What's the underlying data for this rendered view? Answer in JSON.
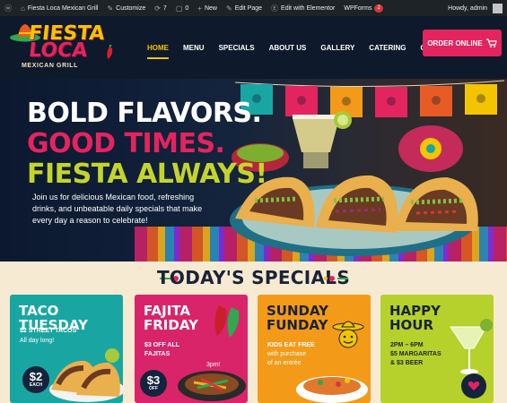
{
  "admin_bar": {
    "site_name": "Fiesta Loca Mexican Grill",
    "customize": "Customize",
    "updates": "7",
    "comments": "0",
    "new": "New",
    "edit_page": "Edit Page",
    "elementor": "Edit with Elementor",
    "wpforms": "WPForms",
    "wpforms_count": "2",
    "howdy": "Howdy, admin"
  },
  "logo": {
    "line1": "FIESTA",
    "line2": "LOCA",
    "sub": "MEXICAN GRILL"
  },
  "nav": {
    "items": [
      "HOME",
      "MENU",
      "SPECIALS",
      "ABOUT US",
      "GALLERY",
      "CATERING",
      "CONTACT"
    ],
    "order": "ORDER ONLINE"
  },
  "hero": {
    "line1": "BOLD FLAVORS.",
    "line2": "GOOD TIMES.",
    "line3": "FIESTA ALWAYS!",
    "text": "Join us for delicious Mexican food, refreshing drinks, and unbeatable daily specials that make every day a reason to celebrate!"
  },
  "specials": {
    "title": "TODAY'S SPECIALS",
    "cards": [
      {
        "title": "TACO TUESDAY",
        "line1": "$2 STREET TACOS",
        "line2": "All day long!",
        "badge": "$2",
        "badge_sub": "EACH"
      },
      {
        "title": "FAJITA FRIDAY",
        "line1": "$3 OFF ALL",
        "line2": "FAJITAS",
        "extra": "3pm!",
        "badge": "$3",
        "badge_sub": "OFF"
      },
      {
        "title": "SUNDAY FUNDAY",
        "line1": "KIDS EAT FREE",
        "line2": "with purchase",
        "line3": "of an entrée"
      },
      {
        "title": "HAPPY HOUR",
        "line1": "2PM – 6PM",
        "line2": "$5 MARGARITAS",
        "line3": "& $3 BEER"
      }
    ]
  },
  "colors": {
    "brand_pink": "#e3245f",
    "brand_yellow": "#f5c400",
    "navy": "#0e1a2c",
    "teal": "#19a6a3",
    "orange": "#f39a19",
    "lime": "#b6d12b"
  }
}
